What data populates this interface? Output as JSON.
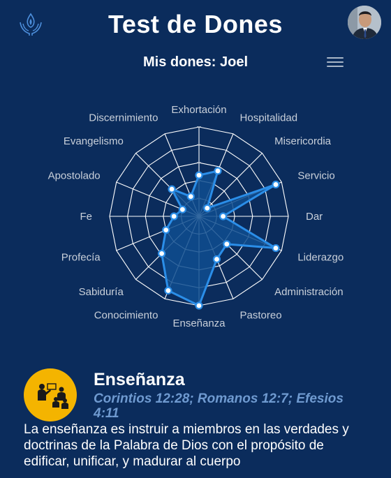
{
  "header": {
    "logo_icon": "flame-hands-icon",
    "title": "Test de Dones",
    "avatar_icon": "user-avatar"
  },
  "subheader": {
    "title": "Mis dones: Joel",
    "menu_icon": "hamburger-menu-icon"
  },
  "chart_data": {
    "type": "radar",
    "categories": [
      "Exhortación",
      "Hospitalidad",
      "Misericordia",
      "Servicio",
      "Dar",
      "Liderazgo",
      "Administración",
      "Pastoreo",
      "Enseñanza",
      "Conocimiento",
      "Sabiduría",
      "Profecía",
      "Fe",
      "Apostolado",
      "Evangelismo",
      "Discernimiento"
    ],
    "values": [
      46,
      55,
      13,
      93,
      27,
      93,
      44,
      52,
      100,
      90,
      59,
      40,
      28,
      20,
      43,
      24
    ],
    "rlim": [
      0,
      100
    ],
    "rings": 5,
    "line_color": "#2b8ee8",
    "fill_color": "#0f4d8f",
    "grid_color": "#ffffff"
  },
  "gift": {
    "title": "Enseñanza",
    "icon": "teaching-icon",
    "icon_color": "#f4b400",
    "references": "Corintios 12:28; Romanos 12:7; Efesios 4:11",
    "description": "La enseñanza es instruir a miembros en las verdades y doctrinas de la Palabra de Dios con el propósito de edificar, unificar, y madurar al cuerpo"
  }
}
